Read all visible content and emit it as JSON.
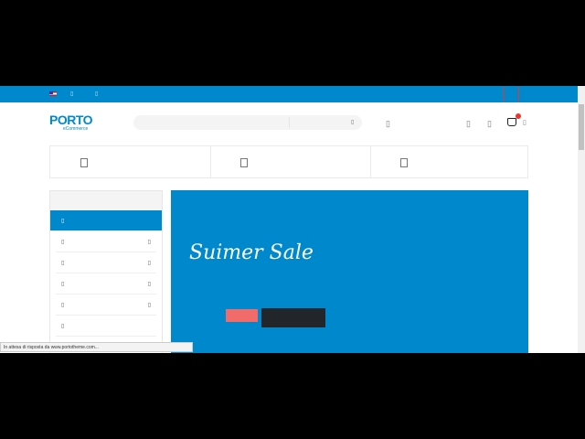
{
  "topbar": {
    "flag": "us-flag-icon"
  },
  "header": {
    "logo_main": "PORTO",
    "logo_sub": "eCommerce",
    "search_icon": "search-icon"
  },
  "sidebar": {
    "items": [
      "",
      "",
      "",
      "",
      "",
      ""
    ]
  },
  "banner": {
    "title": "Suimer Sale"
  },
  "status": {
    "text": "In attesa di risposta da www.portotheme.com..."
  },
  "colors": {
    "accent": "#0088cc",
    "pink": "#f26b6b",
    "dark": "#222529"
  }
}
